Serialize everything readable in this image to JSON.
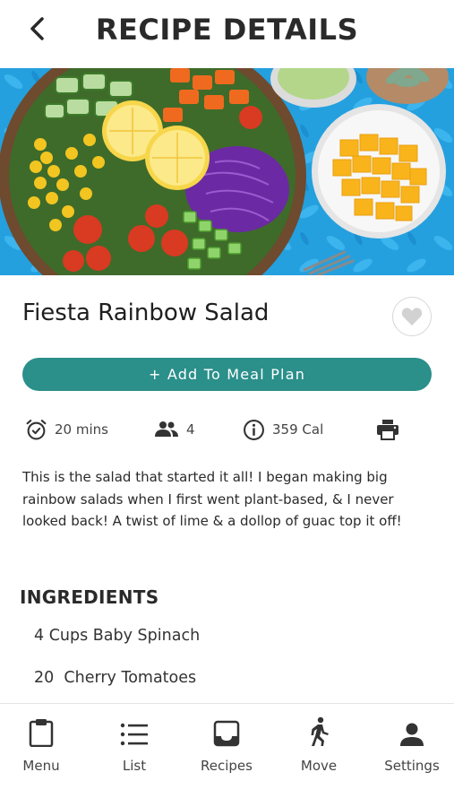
{
  "header": {
    "title": "RECIPE DETAILS"
  },
  "recipe": {
    "name": "Fiesta Rainbow Salad",
    "meal_plan_label": "+ Add To Meal Plan",
    "stats": {
      "time": "20 mins",
      "servings": "4",
      "calories": "359 Cal"
    },
    "description": "This is the salad that started it all! I began making big rainbow salads when I first went plant-based, & I never looked back! A twist of lime & a dollop of guac top it off!"
  },
  "ingredients": {
    "title": "INGREDIENTS",
    "items": [
      "4 Cups Baby Spinach",
      "20  Cherry Tomatoes"
    ]
  },
  "tabs": [
    {
      "label": "Menu",
      "icon": "clipboard-icon"
    },
    {
      "label": "List",
      "icon": "list-icon"
    },
    {
      "label": "Recipes",
      "icon": "inbox-icon"
    },
    {
      "label": "Move",
      "icon": "walking-icon"
    },
    {
      "label": "Settings",
      "icon": "person-icon"
    }
  ],
  "colors": {
    "accent": "#2b8f8a",
    "text": "#2a2a2a"
  }
}
